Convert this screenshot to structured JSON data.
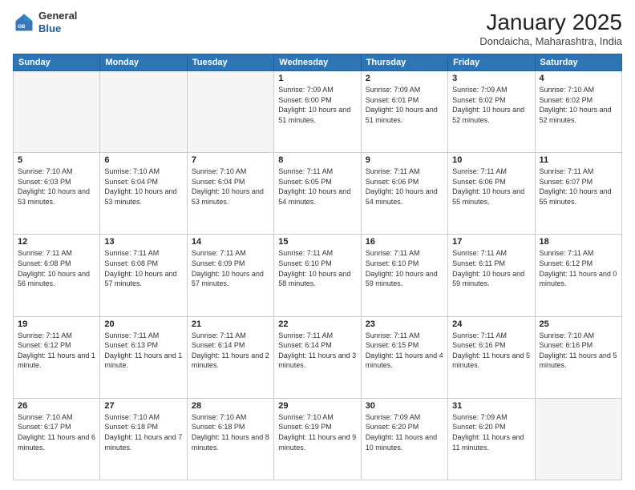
{
  "header": {
    "logo_line1": "General",
    "logo_line2": "Blue",
    "month_title": "January 2025",
    "location": "Dondaicha, Maharashtra, India"
  },
  "weekdays": [
    "Sunday",
    "Monday",
    "Tuesday",
    "Wednesday",
    "Thursday",
    "Friday",
    "Saturday"
  ],
  "weeks": [
    [
      {
        "day": "",
        "empty": true
      },
      {
        "day": "",
        "empty": true
      },
      {
        "day": "",
        "empty": true
      },
      {
        "day": "1",
        "sunrise": "7:09 AM",
        "sunset": "6:00 PM",
        "daylight": "10 hours and 51 minutes."
      },
      {
        "day": "2",
        "sunrise": "7:09 AM",
        "sunset": "6:01 PM",
        "daylight": "10 hours and 51 minutes."
      },
      {
        "day": "3",
        "sunrise": "7:09 AM",
        "sunset": "6:02 PM",
        "daylight": "10 hours and 52 minutes."
      },
      {
        "day": "4",
        "sunrise": "7:10 AM",
        "sunset": "6:02 PM",
        "daylight": "10 hours and 52 minutes."
      }
    ],
    [
      {
        "day": "5",
        "sunrise": "7:10 AM",
        "sunset": "6:03 PM",
        "daylight": "10 hours and 53 minutes."
      },
      {
        "day": "6",
        "sunrise": "7:10 AM",
        "sunset": "6:04 PM",
        "daylight": "10 hours and 53 minutes."
      },
      {
        "day": "7",
        "sunrise": "7:10 AM",
        "sunset": "6:04 PM",
        "daylight": "10 hours and 53 minutes."
      },
      {
        "day": "8",
        "sunrise": "7:11 AM",
        "sunset": "6:05 PM",
        "daylight": "10 hours and 54 minutes."
      },
      {
        "day": "9",
        "sunrise": "7:11 AM",
        "sunset": "6:06 PM",
        "daylight": "10 hours and 54 minutes."
      },
      {
        "day": "10",
        "sunrise": "7:11 AM",
        "sunset": "6:06 PM",
        "daylight": "10 hours and 55 minutes."
      },
      {
        "day": "11",
        "sunrise": "7:11 AM",
        "sunset": "6:07 PM",
        "daylight": "10 hours and 55 minutes."
      }
    ],
    [
      {
        "day": "12",
        "sunrise": "7:11 AM",
        "sunset": "6:08 PM",
        "daylight": "10 hours and 56 minutes."
      },
      {
        "day": "13",
        "sunrise": "7:11 AM",
        "sunset": "6:08 PM",
        "daylight": "10 hours and 57 minutes."
      },
      {
        "day": "14",
        "sunrise": "7:11 AM",
        "sunset": "6:09 PM",
        "daylight": "10 hours and 57 minutes."
      },
      {
        "day": "15",
        "sunrise": "7:11 AM",
        "sunset": "6:10 PM",
        "daylight": "10 hours and 58 minutes."
      },
      {
        "day": "16",
        "sunrise": "7:11 AM",
        "sunset": "6:10 PM",
        "daylight": "10 hours and 59 minutes."
      },
      {
        "day": "17",
        "sunrise": "7:11 AM",
        "sunset": "6:11 PM",
        "daylight": "10 hours and 59 minutes."
      },
      {
        "day": "18",
        "sunrise": "7:11 AM",
        "sunset": "6:12 PM",
        "daylight": "11 hours and 0 minutes."
      }
    ],
    [
      {
        "day": "19",
        "sunrise": "7:11 AM",
        "sunset": "6:12 PM",
        "daylight": "11 hours and 1 minute."
      },
      {
        "day": "20",
        "sunrise": "7:11 AM",
        "sunset": "6:13 PM",
        "daylight": "11 hours and 1 minute."
      },
      {
        "day": "21",
        "sunrise": "7:11 AM",
        "sunset": "6:14 PM",
        "daylight": "11 hours and 2 minutes."
      },
      {
        "day": "22",
        "sunrise": "7:11 AM",
        "sunset": "6:14 PM",
        "daylight": "11 hours and 3 minutes."
      },
      {
        "day": "23",
        "sunrise": "7:11 AM",
        "sunset": "6:15 PM",
        "daylight": "11 hours and 4 minutes."
      },
      {
        "day": "24",
        "sunrise": "7:11 AM",
        "sunset": "6:16 PM",
        "daylight": "11 hours and 5 minutes."
      },
      {
        "day": "25",
        "sunrise": "7:10 AM",
        "sunset": "6:16 PM",
        "daylight": "11 hours and 5 minutes."
      }
    ],
    [
      {
        "day": "26",
        "sunrise": "7:10 AM",
        "sunset": "6:17 PM",
        "daylight": "11 hours and 6 minutes."
      },
      {
        "day": "27",
        "sunrise": "7:10 AM",
        "sunset": "6:18 PM",
        "daylight": "11 hours and 7 minutes."
      },
      {
        "day": "28",
        "sunrise": "7:10 AM",
        "sunset": "6:18 PM",
        "daylight": "11 hours and 8 minutes."
      },
      {
        "day": "29",
        "sunrise": "7:10 AM",
        "sunset": "6:19 PM",
        "daylight": "11 hours and 9 minutes."
      },
      {
        "day": "30",
        "sunrise": "7:09 AM",
        "sunset": "6:20 PM",
        "daylight": "11 hours and 10 minutes."
      },
      {
        "day": "31",
        "sunrise": "7:09 AM",
        "sunset": "6:20 PM",
        "daylight": "11 hours and 11 minutes."
      },
      {
        "day": "",
        "empty": true
      }
    ]
  ]
}
